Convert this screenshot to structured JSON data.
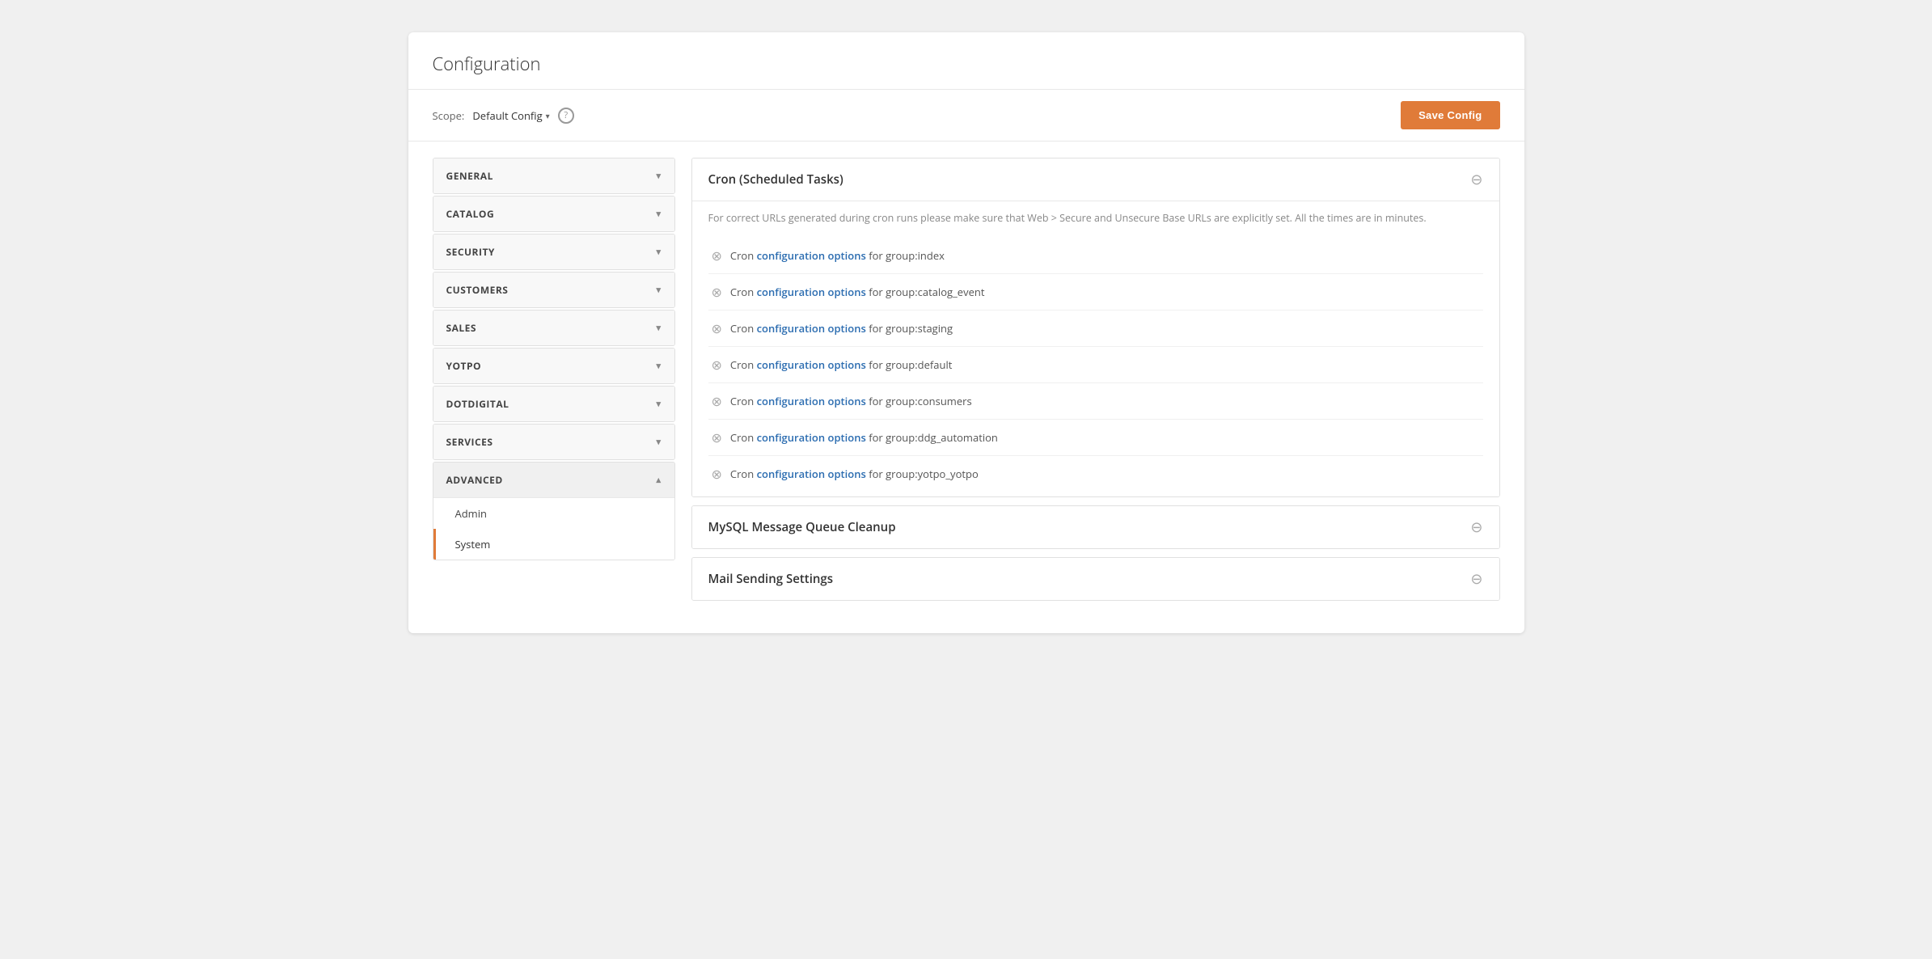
{
  "page": {
    "title": "Configuration"
  },
  "toolbar": {
    "scope_label": "Scope:",
    "scope_value": "Default Config",
    "help_icon": "?",
    "save_button_label": "Save Config"
  },
  "sidebar": {
    "items": [
      {
        "id": "general",
        "label": "GENERAL",
        "expanded": false
      },
      {
        "id": "catalog",
        "label": "CATALOG",
        "expanded": false
      },
      {
        "id": "security",
        "label": "SECURITY",
        "expanded": false
      },
      {
        "id": "customers",
        "label": "CUSTOMERS",
        "expanded": false
      },
      {
        "id": "sales",
        "label": "SALES",
        "expanded": false
      },
      {
        "id": "yotpo",
        "label": "YOTPO",
        "expanded": false
      },
      {
        "id": "dotdigital",
        "label": "DOTDIGITAL",
        "expanded": false
      },
      {
        "id": "services",
        "label": "SERVICES",
        "expanded": false
      },
      {
        "id": "advanced",
        "label": "ADVANCED",
        "expanded": true,
        "sub_items": [
          {
            "id": "admin",
            "label": "Admin",
            "active": false
          },
          {
            "id": "system",
            "label": "System",
            "active": true
          }
        ]
      }
    ]
  },
  "main": {
    "cron_section": {
      "title": "Cron (Scheduled Tasks)",
      "info_text": "For correct URLs generated during cron runs please make sure that Web > Secure and Unsecure Base URLs are explicitly set. All the times are in minutes.",
      "items": [
        {
          "id": "group_index",
          "label_prefix": "Cron ",
          "label_bold": "configuration options",
          "label_suffix": " for group:index"
        },
        {
          "id": "group_catalog_event",
          "label_prefix": "Cron ",
          "label_bold": "configuration options",
          "label_suffix": " for group:catalog_event"
        },
        {
          "id": "group_staging",
          "label_prefix": "Cron ",
          "label_bold": "configuration options",
          "label_suffix": " for group:staging"
        },
        {
          "id": "group_default",
          "label_prefix": "Cron ",
          "label_bold": "configuration options",
          "label_suffix": " for group:default"
        },
        {
          "id": "group_consumers",
          "label_prefix": "Cron ",
          "label_bold": "configuration options",
          "label_suffix": " for group:consumers"
        },
        {
          "id": "group_ddg_automation",
          "label_prefix": "Cron ",
          "label_bold": "configuration options",
          "label_suffix": " for group:ddg_automation"
        },
        {
          "id": "group_yotpo_yotpo",
          "label_prefix": "Cron ",
          "label_bold": "configuration options",
          "label_suffix": " for group:yotpo_yotpo"
        }
      ]
    },
    "mysql_section": {
      "title": "MySQL Message Queue Cleanup"
    },
    "mail_section": {
      "title": "Mail Sending Settings"
    }
  },
  "colors": {
    "accent": "#e07b39",
    "link": "#2b6cb0"
  }
}
